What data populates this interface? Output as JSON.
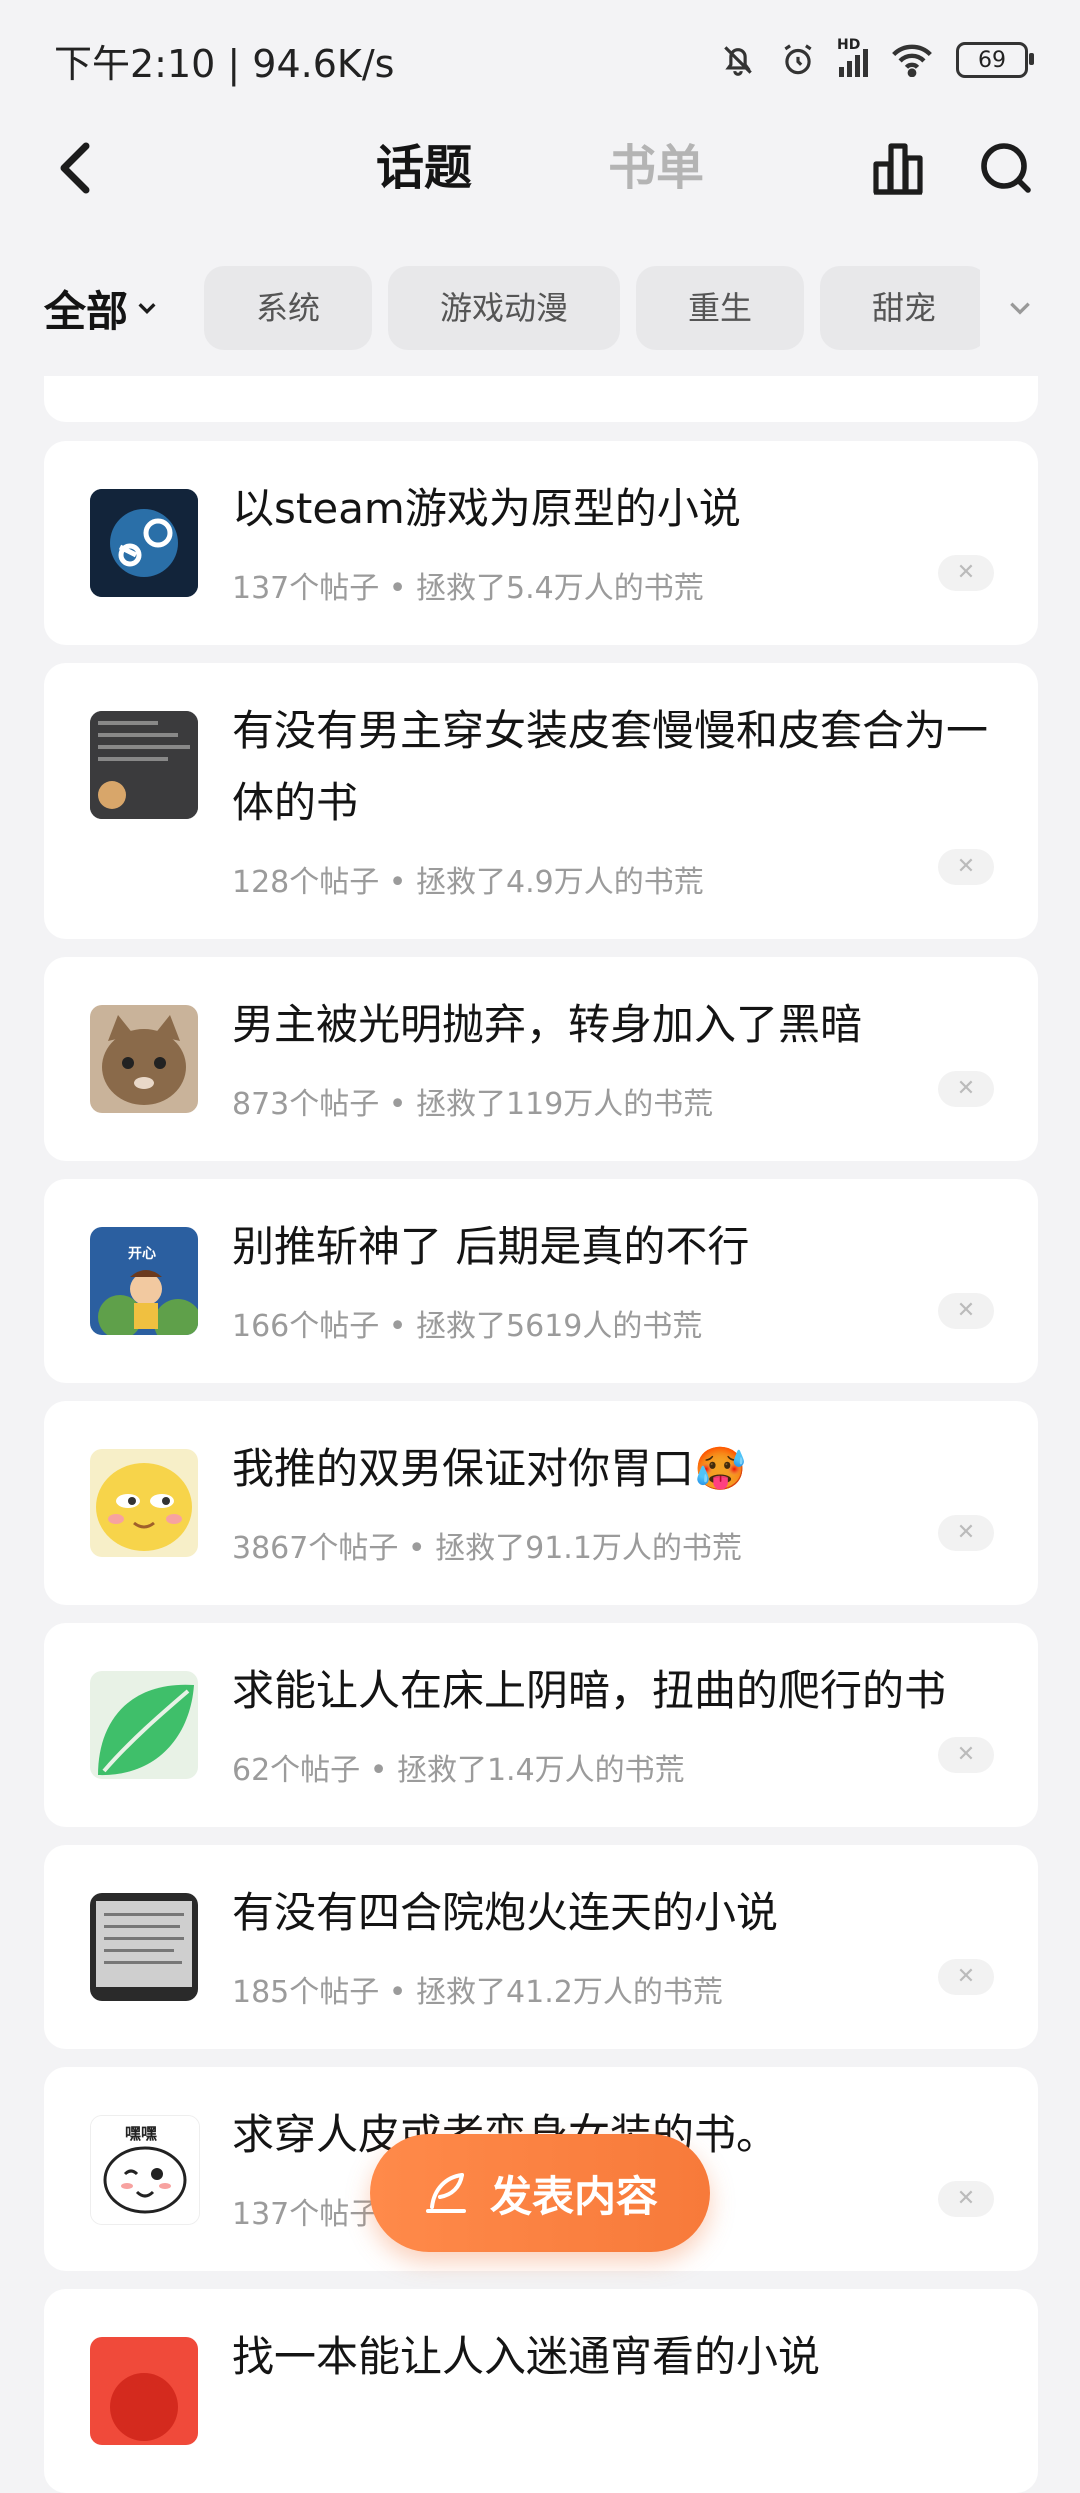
{
  "status_bar": {
    "time_speed": "下午2:10 | 94.6K/s",
    "battery": "69",
    "network": "HD"
  },
  "nav": {
    "tabs": [
      {
        "label": "话题",
        "active": true
      },
      {
        "label": "书单",
        "active": false
      }
    ]
  },
  "filter": {
    "all_label": "全部",
    "chips": [
      "系统",
      "游戏动漫",
      "重生",
      "甜宠"
    ]
  },
  "topics": [
    {
      "title": "以steam游戏为原型的小说",
      "meta": "137个帖子 • 拯救了5.4万人的书荒",
      "thumb": "steam-logo"
    },
    {
      "title": "有没有男主穿女装皮套慢慢和皮套合为一体的书",
      "meta": "128个帖子 • 拯救了4.9万人的书荒",
      "thumb": "meme-doge"
    },
    {
      "title": "男主被光明抛弃，转身加入了黑暗",
      "meta": "873个帖子 • 拯救了119万人的书荒",
      "thumb": "cat-face"
    },
    {
      "title": "别推斩神了 后期是真的不行",
      "meta": "166个帖子 • 拯救了5619人的书荒",
      "thumb": "happy-kid",
      "thumb_text": "开心"
    },
    {
      "title": "我推的双男保证对你胃口🥵",
      "meta": "3867个帖子 • 拯救了91.1万人的书荒",
      "thumb": "yellow-emoji"
    },
    {
      "title": "求能让人在床上阴暗，扭曲的爬行的书",
      "meta": "62个帖子 • 拯救了1.4万人的书荒",
      "thumb": "green-leaf"
    },
    {
      "title": "有没有四合院炮火连天的小说",
      "meta": "185个帖子 • 拯救了41.2万人的书荒",
      "thumb": "paper-doc"
    },
    {
      "title": "求穿人皮或者变身女装的书。",
      "meta": "137个帖子 • 拯救了",
      "thumb": "cartoon-face",
      "thumb_text": "嘿嘿"
    },
    {
      "title": "找一本能让人入迷通宵看的小说",
      "meta": "",
      "thumb": "red-thumb"
    }
  ],
  "fab": {
    "label": "发表内容"
  },
  "colors": {
    "accent": "#f77a3a",
    "background": "#f3f3f5"
  }
}
